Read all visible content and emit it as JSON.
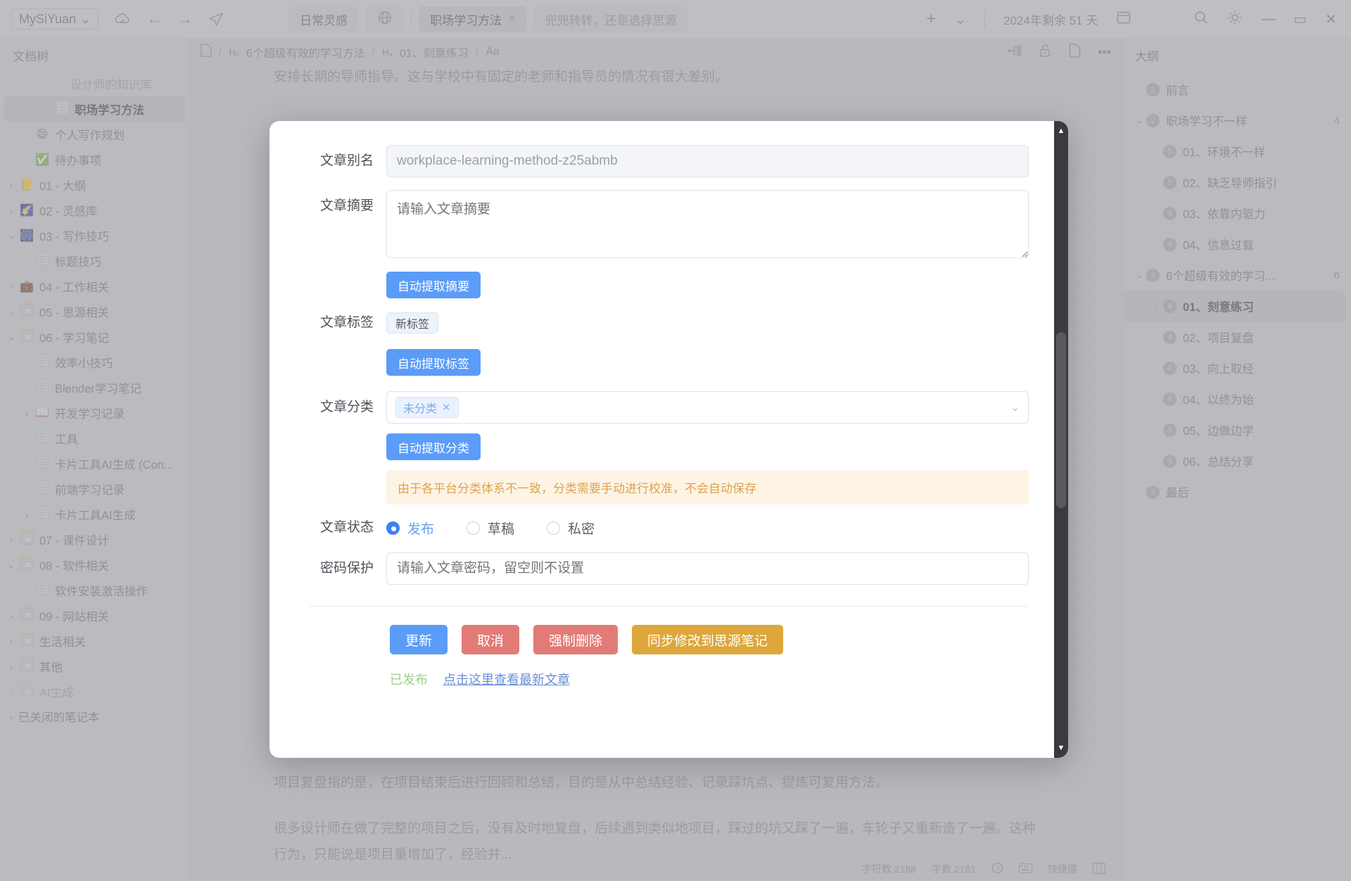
{
  "topbar": {
    "workspace": "MySiYuan",
    "workspace_caret": "chevron-down-icon",
    "icons": [
      "cloud-sync-icon",
      "back-arrow-icon",
      "forward-arrow-icon",
      "send-icon"
    ],
    "tabs": [
      {
        "label": "日常灵感",
        "type": "soft",
        "closable": false
      },
      {
        "label": "",
        "type": "globe",
        "closable": false
      },
      {
        "label": "职场学习方法",
        "type": "active",
        "closable": true,
        "close": "×"
      },
      {
        "label": "兜兜转转，还是选择思源",
        "type": "ghost",
        "closable": false
      }
    ],
    "add_tab": "+",
    "tab_menu": "⌄",
    "days_left": "2024年剩余 51 天",
    "layout_icon": "layout-icon",
    "search_icon": "search-icon",
    "theme_icon": "sun-icon",
    "minimize": "—",
    "maximize": "▭",
    "close": "✕"
  },
  "sidebar": {
    "title": "文档树",
    "items": [
      {
        "label": "设计师的知识库",
        "indent": 2,
        "marker": "dot",
        "icon": "page-icon",
        "faded": true,
        "selected": false
      },
      {
        "label": "职场学习方法",
        "indent": 2,
        "marker": "dot",
        "icon": "page-icon",
        "faded": false,
        "selected": true
      },
      {
        "label": "个人写作规划",
        "indent": 1,
        "marker": "dot",
        "icon": "😄",
        "emoji": true,
        "selected": false
      },
      {
        "label": "待办事项",
        "indent": 1,
        "marker": "dot",
        "icon": "✅",
        "emoji": true,
        "selected": false
      },
      {
        "label": "01 - 大纲",
        "indent": 0,
        "marker": "right",
        "icon": "📒",
        "emoji": true,
        "selected": false
      },
      {
        "label": "02 - 灵感库",
        "indent": 0,
        "marker": "right",
        "icon": "🌠",
        "emoji": true,
        "selected": false
      },
      {
        "label": "03 - 写作技巧",
        "indent": 0,
        "marker": "down",
        "icon": "🎆",
        "emoji": true,
        "selected": false
      },
      {
        "label": "标题技巧",
        "indent": 1,
        "marker": "dot",
        "icon": "page-icon",
        "selected": false
      },
      {
        "label": "04 - 工作相关",
        "indent": 0,
        "marker": "right",
        "icon": "💼",
        "emoji": true,
        "selected": false
      },
      {
        "label": "05 - 思源相关",
        "indent": 0,
        "marker": "right",
        "icon": "box-icon",
        "selected": false
      },
      {
        "label": "06 - 学习笔记",
        "indent": 0,
        "marker": "down",
        "icon": "box-icon",
        "selected": false
      },
      {
        "label": "效率小技巧",
        "indent": 1,
        "marker": "dot",
        "icon": "page-icon",
        "selected": false
      },
      {
        "label": "Blender学习笔记",
        "indent": 1,
        "marker": "dot",
        "icon": "page-icon",
        "selected": false
      },
      {
        "label": "开发学习记录",
        "indent": 1,
        "marker": "right",
        "icon": "📖",
        "emoji": true,
        "selected": false
      },
      {
        "label": "工具",
        "indent": 1,
        "marker": "dot",
        "icon": "page-icon",
        "selected": false
      },
      {
        "label": "卡片工具AI生成 (Con...",
        "indent": 1,
        "marker": "dot",
        "icon": "page-icon",
        "selected": false
      },
      {
        "label": "前端学习记录",
        "indent": 1,
        "marker": "dot",
        "icon": "page-icon",
        "selected": false
      },
      {
        "label": "卡片工具AI生成",
        "indent": 1,
        "marker": "right",
        "icon": "page-icon",
        "selected": false
      },
      {
        "label": "07 - 课件设计",
        "indent": 0,
        "marker": "right",
        "icon": "box-icon",
        "selected": false
      },
      {
        "label": "08 - 软件相关",
        "indent": 0,
        "marker": "down",
        "icon": "box-icon",
        "selected": false
      },
      {
        "label": "软件安装激活操作",
        "indent": 1,
        "marker": "dot",
        "icon": "page-icon",
        "selected": false
      },
      {
        "label": "09 - 网站相关",
        "indent": 0,
        "marker": "right",
        "icon": "box-icon",
        "selected": false
      },
      {
        "label": "生活相关",
        "indent": 0,
        "marker": "right",
        "icon": "box-icon",
        "selected": false
      },
      {
        "label": "其他",
        "indent": 0,
        "marker": "right",
        "icon": "box-icon",
        "selected": false
      },
      {
        "label": "AI生成",
        "indent": 0,
        "marker": "right",
        "icon": "box-icon",
        "faded": true,
        "selected": false
      }
    ],
    "closed_notebooks": "已关闭的笔记本",
    "closed_arrow": "›"
  },
  "breadcrumb": {
    "doc_icon": "document-icon",
    "parts": [
      {
        "level": "H₂",
        "label": "6个超级有效的学习方法"
      },
      {
        "level": "H₄",
        "label": "01、刻意练习"
      }
    ],
    "sep": "/",
    "font_icon": "Aa",
    "right_icons": [
      "graph-icon",
      "unlock-icon",
      "file-icon",
      "more-icon"
    ]
  },
  "editor": {
    "paragraph_top": "安排长期的导师指导。这与学校中有固定的老师和指导员的情况有很大差别。",
    "paragraph_1": "项目复盘指的是，在项目结束后进行回顾和总结，目的是从中总结经验、记录踩坑点、提炼可复用方法。",
    "paragraph_2": "很多设计师在做了完整的项目之后，没有及时地复盘，后续遇到类似地项目，踩过的坑又踩了一遍，车轮子又重新造了一遍。这种行为，只能说是项目量增加了，经验并..."
  },
  "statusbar": {
    "chars": "字符数 2188",
    "words": "字数 2161",
    "help_icon": "help-icon",
    "shortcut": "快捷键",
    "shortcut_icon": "keyboard-icon",
    "grid_icon": "grid-icon"
  },
  "outline": {
    "title": "大纲",
    "items": [
      {
        "label": "前言",
        "level": "2",
        "indent": 0,
        "marker": "dot",
        "count": "",
        "selected": false
      },
      {
        "label": "职场学习不一样",
        "level": "2",
        "indent": 0,
        "marker": "down",
        "count": "4",
        "selected": false
      },
      {
        "label": "01、环境不一样",
        "level": "5",
        "indent": 1,
        "marker": "dot",
        "count": "",
        "selected": false
      },
      {
        "label": "02、缺乏导师指引",
        "level": "5",
        "indent": 1,
        "marker": "dot",
        "count": "",
        "selected": false
      },
      {
        "label": "03、依靠内驱力",
        "level": "4",
        "indent": 1,
        "marker": "dot",
        "count": "",
        "selected": false
      },
      {
        "label": "04、信息过载",
        "level": "4",
        "indent": 1,
        "marker": "dot",
        "count": "",
        "selected": false
      },
      {
        "label": "6个超级有效的学习...",
        "level": "2",
        "indent": 0,
        "marker": "down",
        "count": "6",
        "selected": false
      },
      {
        "label": "01、刻意练习",
        "level": "4",
        "indent": 1,
        "marker": "dot",
        "count": "",
        "selected": true
      },
      {
        "label": "02、项目复盘",
        "level": "4",
        "indent": 1,
        "marker": "dot",
        "count": "",
        "selected": false
      },
      {
        "label": "03、向上取经",
        "level": "4",
        "indent": 1,
        "marker": "dot",
        "count": "",
        "selected": false
      },
      {
        "label": "04、以终为始",
        "level": "4",
        "indent": 1,
        "marker": "dot",
        "count": "",
        "selected": false
      },
      {
        "label": "05、边做边学",
        "level": "4",
        "indent": 1,
        "marker": "dot",
        "count": "",
        "selected": false
      },
      {
        "label": "06、总结分享",
        "level": "4",
        "indent": 1,
        "marker": "dot",
        "count": "",
        "selected": false
      },
      {
        "label": "最后",
        "level": "2",
        "indent": 0,
        "marker": "dot",
        "count": "",
        "selected": false
      }
    ]
  },
  "modal": {
    "slug": {
      "label": "文章别名",
      "value": "workplace-learning-method-z25abmb"
    },
    "summary": {
      "label": "文章摘要",
      "placeholder": "请输入文章摘要",
      "value": "",
      "auto_button": "自动提取摘要"
    },
    "tags": {
      "label": "文章标签",
      "chip": "新标签",
      "auto_button": "自动提取标签"
    },
    "category": {
      "label": "文章分类",
      "chip": "未分类",
      "chip_close": "✕",
      "caret": "chevron-down-icon",
      "auto_button": "自动提取分类",
      "notice": "由于各平台分类体系不一致，分类需要手动进行校准，不会自动保存"
    },
    "status": {
      "label": "文章状态",
      "options": [
        {
          "label": "发布",
          "selected": true
        },
        {
          "label": "草稿",
          "selected": false
        },
        {
          "label": "私密",
          "selected": false
        }
      ]
    },
    "password": {
      "label": "密码保护",
      "placeholder": "请输入文章密码，留空则不设置",
      "value": ""
    },
    "actions": [
      {
        "label": "更新",
        "color": "blue"
      },
      {
        "label": "取消",
        "color": "red"
      },
      {
        "label": "强制删除",
        "color": "red"
      },
      {
        "label": "同步修改到思源笔记",
        "color": "gold"
      }
    ],
    "published_text": "已发布",
    "view_link": "点击这里查看最新文章",
    "scroll_up": "▲",
    "scroll_down": "▼"
  }
}
